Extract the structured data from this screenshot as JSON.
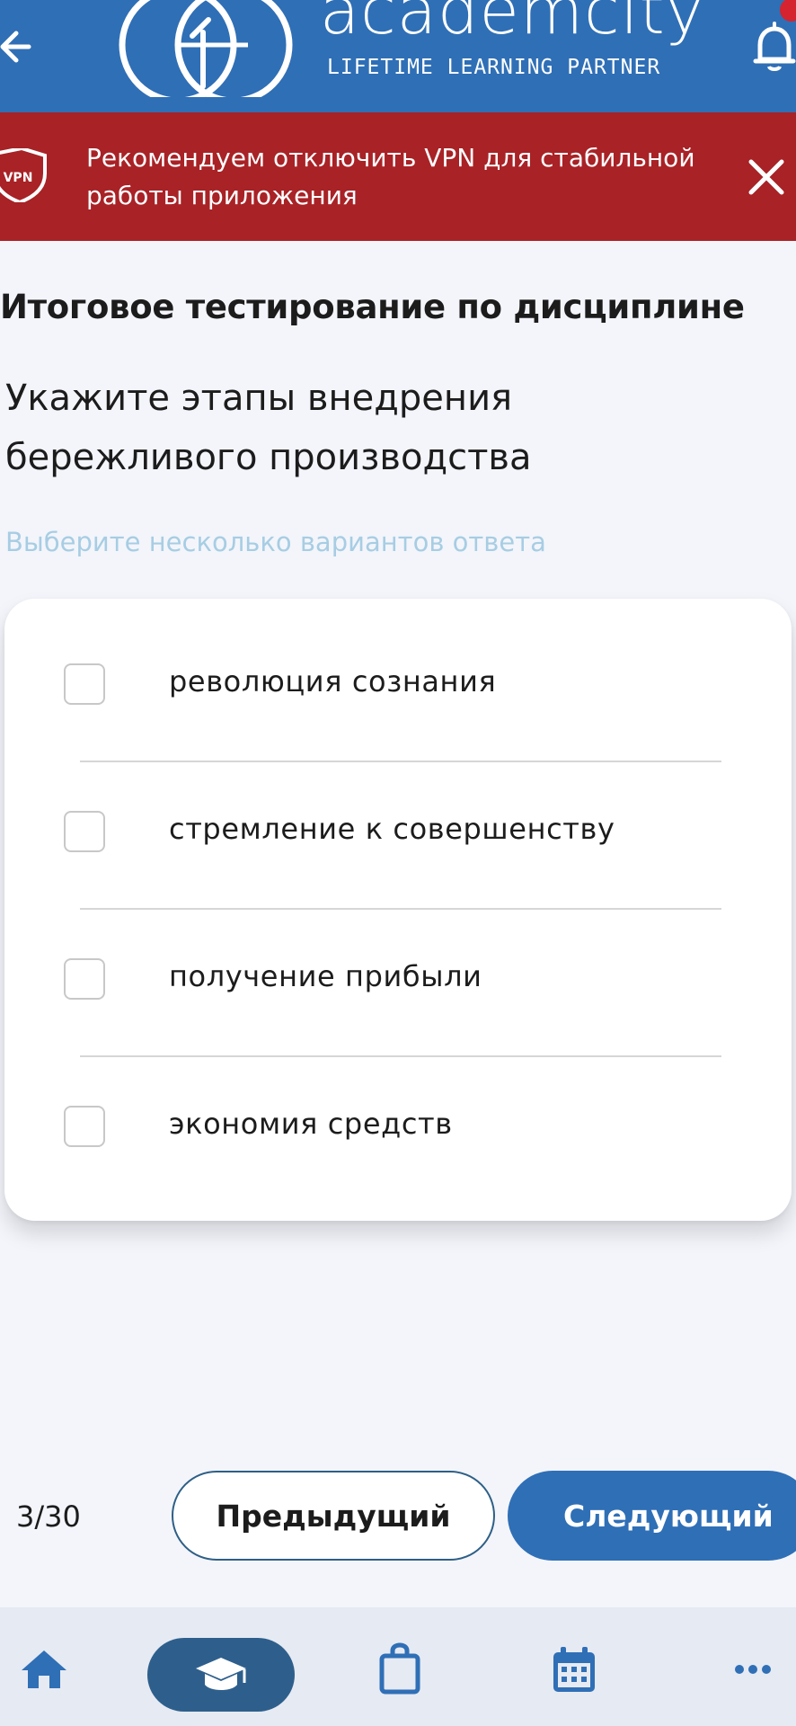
{
  "header": {
    "logo_word": "academcity",
    "logo_tagline": "LIFETIME LEARNING PARTNER",
    "icons": [
      "back-arrow-icon",
      "logo-mark-icon",
      "bell-icon"
    ],
    "colors": {
      "bar": "#2f6fb6",
      "notification_dot": "#d5232f"
    }
  },
  "vpn_banner": {
    "badge_text": "VPN",
    "message": "Рекомендуем отключить VPN для стабильной работы приложения",
    "icons": [
      "shield-icon",
      "close-icon"
    ],
    "color": "#a82226"
  },
  "test": {
    "title": "Итоговое тестирование по дисциплине",
    "question": "Укажите этапы внедрения бережливого производства",
    "hint": "Выберите несколько вариантов ответа",
    "options": [
      {
        "label": "революция сознания",
        "checked": false
      },
      {
        "label": "стремление к совершенству",
        "checked": false
      },
      {
        "label": "получение прибыли",
        "checked": false
      },
      {
        "label": "экономия средств",
        "checked": false
      }
    ]
  },
  "pagination": {
    "counter": "3/30",
    "prev_label": "Предыдущий",
    "next_label": "Следующий"
  },
  "bottom_nav": {
    "items": [
      "home-icon",
      "courses-icon",
      "shop-icon",
      "calendar-icon",
      "more-icon"
    ],
    "active": "courses-icon",
    "active_color": "#2e5f8c"
  }
}
